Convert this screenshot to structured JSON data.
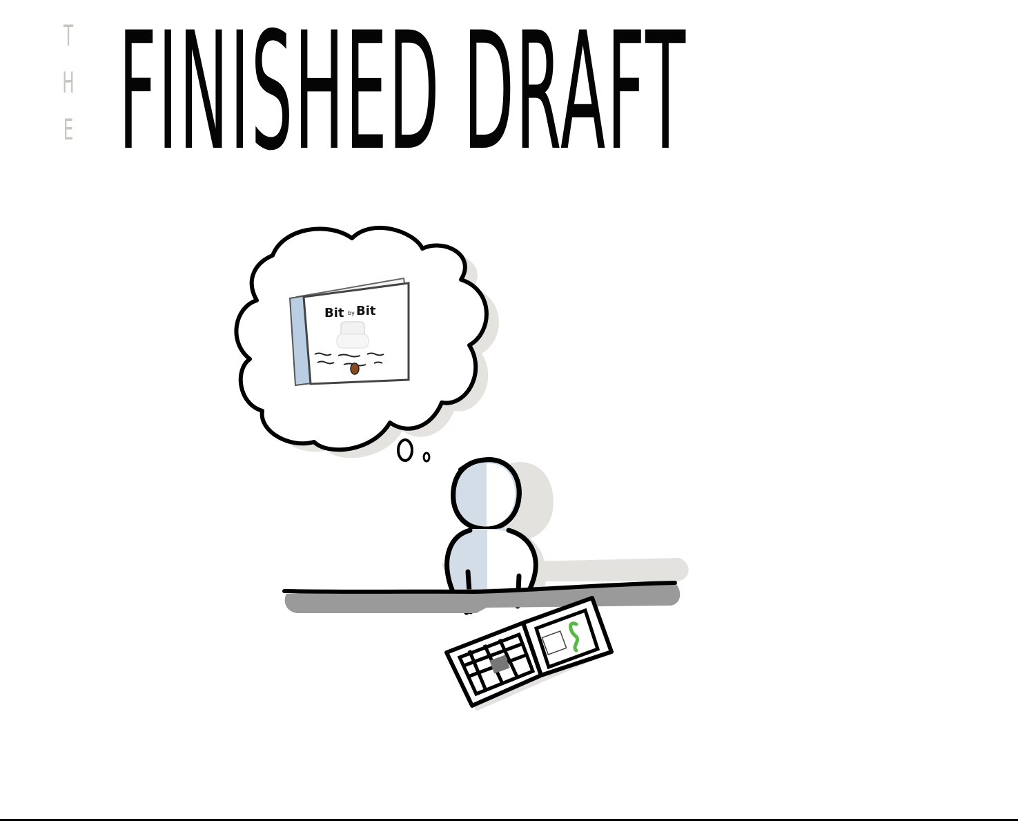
{
  "title": {
    "prefix_letters": [
      "T",
      "H",
      "E"
    ],
    "main": "FINISHED DRAFT",
    "prefix_color": "#c9c6c1",
    "main_color": "#050505"
  },
  "thought_book": {
    "title_left": "Bit",
    "title_mid": "by",
    "title_right": "Bit",
    "spine_color": "#b9cde3"
  },
  "figure": {
    "body_color": "#d2dde8",
    "outline_color": "#000000",
    "shadow_color": "#e2e1df",
    "desk_shadow_color": "#9a9a9a"
  },
  "open_book": {
    "caterpillar_color": "#57b846"
  }
}
